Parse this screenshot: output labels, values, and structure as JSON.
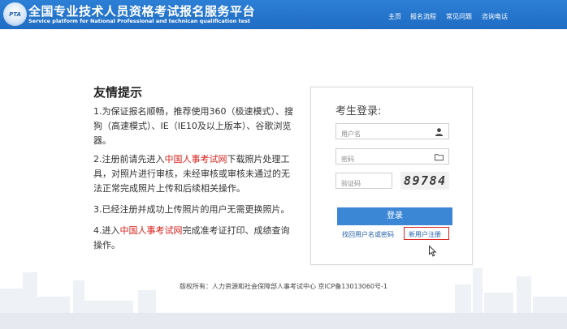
{
  "header": {
    "logo_text": "PTA",
    "title": "全国专业技术人员资格考试报名服务平台",
    "subtitle": "Service platform for National Professional and technican qualification test",
    "nav": [
      {
        "label": "主页"
      },
      {
        "label": "报名流程"
      },
      {
        "label": "常见问题"
      },
      {
        "label": "咨询电话"
      }
    ]
  },
  "tips": {
    "title": "友情提示",
    "items": [
      {
        "text": "1.为保证报名顺畅，推荐使用360（极速模式）、搜狗（高速模式）、IE（IE10及以上版本）、谷歌浏览器。"
      },
      {
        "pre": "2.注册前请先进入",
        "link": "中国人事考试网",
        "post": "下载照片处理工具，对照片进行审核，未经审核或审核未通过的无法正常完成照片上传和后续相关操作。"
      },
      {
        "text": "3.已经注册并成功上传照片的用户无需更换照片。"
      },
      {
        "pre": "4.进入",
        "link": "中国人事考试网",
        "post": "完成准考证打印、成绩查询操作。"
      }
    ]
  },
  "login": {
    "title": "考生登录:",
    "username_placeholder": "用户名",
    "password_placeholder": "密码",
    "captcha_placeholder": "验证码",
    "captcha_text": "89784",
    "login_label": "登录",
    "forgot_label": "找回用户名或密码",
    "register_label": "新用户注册"
  },
  "colors": {
    "header_bg": "#1f6cc3",
    "login_button": "#3b87d6",
    "highlight_red": "#d9201b"
  },
  "footer": {
    "text": "版权所有：人力资源和社会保障部人事考试中心 京ICP备13013060号-1"
  }
}
